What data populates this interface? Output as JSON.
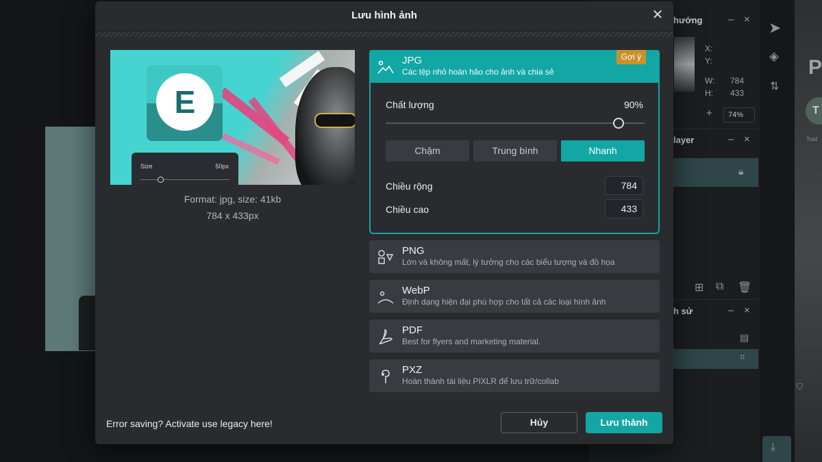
{
  "background": {
    "navigator_title": "hướng",
    "coords": {
      "x_label": "X:",
      "y_label": "Y:",
      "w_label": "W:",
      "w_value": "784",
      "h_label": "H:",
      "h_value": "433"
    },
    "zoom": "74%",
    "layer_title": "layer",
    "history_title": "h sử",
    "far_letter": "P",
    "far_avatar": "T",
    "far_small": "Trad"
  },
  "dialog": {
    "title": "Lưu hình ảnh",
    "preview_caption_format": "Format: jpg, size: 41kb",
    "preview_caption_dims": "784 x 433px",
    "preview_image": {
      "logo_letter": "E",
      "size_label": "Size",
      "size_value": "50px"
    },
    "formats": [
      {
        "name": "JPG",
        "desc": "Các tệp nhỏ hoàn hảo cho ảnh và chia sẻ",
        "badge": "Gợi ý",
        "icon": "image-icon"
      },
      {
        "name": "PNG",
        "desc": "Lớn và không mất, lý tưởng cho các biểu tượng và đồ họa",
        "icon": "shapes-icon"
      },
      {
        "name": "WebP",
        "desc": "Định dạng hiện đại phù hợp cho tất cả các loại hình ảnh",
        "icon": "webp-icon"
      },
      {
        "name": "PDF",
        "desc": "Best for flyers and marketing material.",
        "icon": "pdf-icon"
      },
      {
        "name": "PXZ",
        "desc": "Hoàn thành tài liệu PIXLR để lưu trữ/collab",
        "icon": "pxz-icon"
      }
    ],
    "jpg_options": {
      "quality_label": "Chất lượng",
      "quality_value": "90%",
      "quality_fraction": 0.9,
      "speed_options": [
        "Chậm",
        "Trung bình",
        "Nhanh"
      ],
      "selected_speed": "Nhanh",
      "width_label": "Chiều rộng",
      "width_value": "784",
      "height_label": "Chiều cao",
      "height_value": "433"
    },
    "legacy_text": "Error saving? Activate use legacy here!",
    "cancel_label": "Hủy",
    "save_label": "Lưu thành"
  },
  "colors": {
    "accent": "#12a7a5",
    "badge": "#c8922a",
    "panel": "#2a2b2f",
    "card": "#393b40"
  }
}
